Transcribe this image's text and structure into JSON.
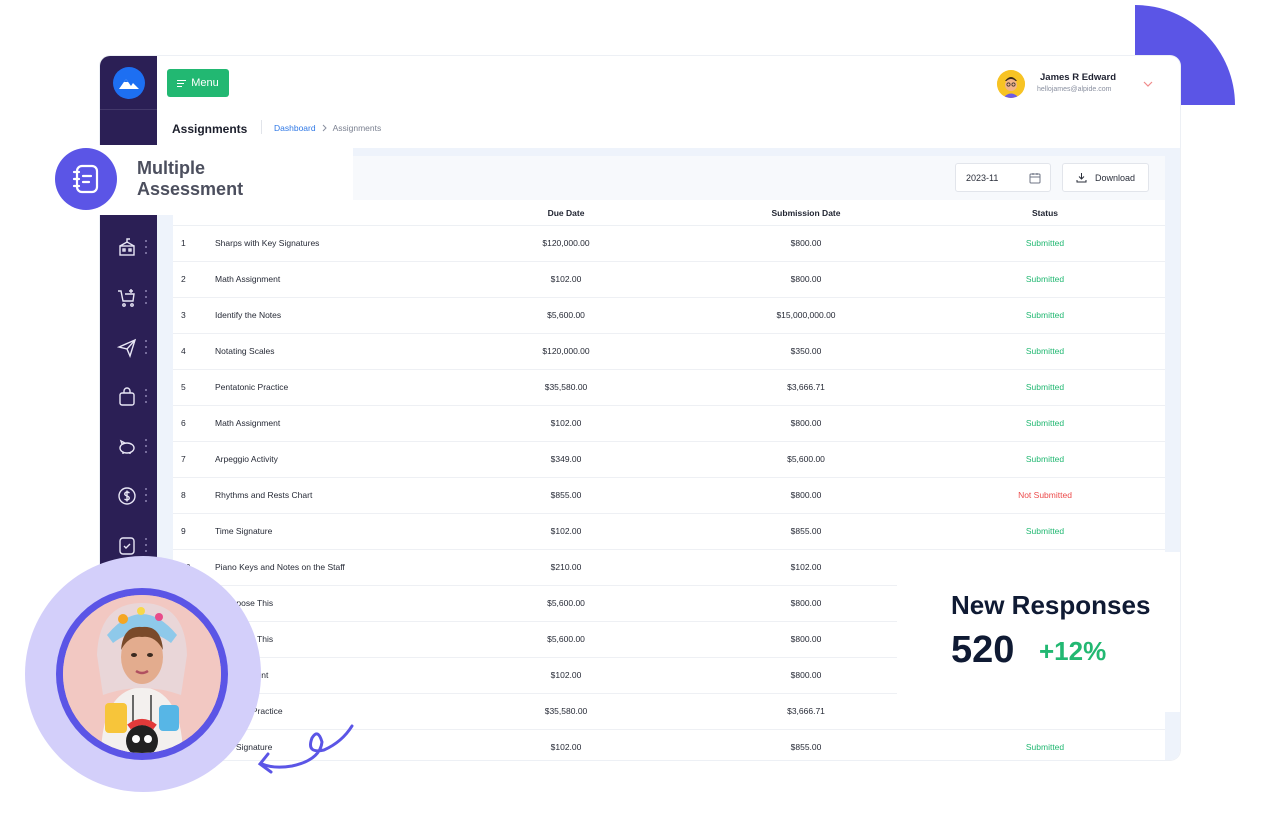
{
  "header": {
    "menu_label": "Menu",
    "user_name": "James R Edward",
    "user_email": "hellojames@alpide.com",
    "page_title": "Assignments",
    "breadcrumb": [
      {
        "label": "Dashboard"
      },
      {
        "label": "Assignments"
      }
    ]
  },
  "sidebar": {
    "items": [
      {
        "icon": "school-icon"
      },
      {
        "icon": "cart-add-icon"
      },
      {
        "icon": "send-icon"
      },
      {
        "icon": "shopping-bag-icon"
      },
      {
        "icon": "piggy-bank-icon"
      },
      {
        "icon": "dollar-circle-icon"
      },
      {
        "icon": "document-check-icon"
      }
    ]
  },
  "toolbar": {
    "date_value": "2023-11",
    "download_label": "Download"
  },
  "table": {
    "columns": {
      "due": "Due Date",
      "submission": "Submission Date",
      "status": "Status"
    },
    "rows": [
      {
        "num": "1",
        "name": "Sharps with Key Signatures",
        "due": "$120,000.00",
        "submission": "$800.00",
        "status": "Submitted",
        "state": "ok"
      },
      {
        "num": "2",
        "name": "Math Assignment",
        "due": "$102.00",
        "submission": "$800.00",
        "status": "Submitted",
        "state": "ok"
      },
      {
        "num": "3",
        "name": "Identify the Notes",
        "due": "$5,600.00",
        "submission": "$15,000,000.00",
        "status": "Submitted",
        "state": "ok"
      },
      {
        "num": "4",
        "name": "Notating Scales",
        "due": "$120,000.00",
        "submission": "$350.00",
        "status": "Submitted",
        "state": "ok"
      },
      {
        "num": "5",
        "name": "Pentatonic Practice",
        "due": "$35,580.00",
        "submission": "$3,666.71",
        "status": "Submitted",
        "state": "ok"
      },
      {
        "num": "6",
        "name": "Math Assignment",
        "due": "$102.00",
        "submission": "$800.00",
        "status": "Submitted",
        "state": "ok"
      },
      {
        "num": "7",
        "name": "Arpeggio Activity",
        "due": "$349.00",
        "submission": "$5,600.00",
        "status": "Submitted",
        "state": "ok"
      },
      {
        "num": "8",
        "name": "Rhythms and Rests Chart",
        "due": "$855.00",
        "submission": "$800.00",
        "status": "Not Submitted",
        "state": "bad"
      },
      {
        "num": "9",
        "name": "Time Signature",
        "due": "$102.00",
        "submission": "$855.00",
        "status": "Submitted",
        "state": "ok"
      },
      {
        "num": "10",
        "name": "Piano Keys and Notes on the Staff",
        "due": "$210.00",
        "submission": "$102.00",
        "status": "",
        "state": "ok"
      },
      {
        "num": "",
        "name": "Transpose This",
        "due": "$5,600.00",
        "submission": "$800.00",
        "status": "",
        "state": "ok"
      },
      {
        "num": "",
        "name": "Transpose This",
        "due": "$5,600.00",
        "submission": "$800.00",
        "status": "",
        "state": "ok"
      },
      {
        "num": "",
        "name": "th Assignment",
        "due": "$102.00",
        "submission": "$800.00",
        "status": "",
        "state": "ok"
      },
      {
        "num": "",
        "name": "entatonic Practice",
        "due": "$35,580.00",
        "submission": "$3,666.71",
        "status": "",
        "state": "ok"
      },
      {
        "num": "",
        "name": "Time Signature",
        "due": "$102.00",
        "submission": "$855.00",
        "status": "Submitted",
        "state": "ok"
      }
    ]
  },
  "feature_badge": {
    "label": "Multiple Assessment",
    "icon": "notebook-icon"
  },
  "stat_card": {
    "title": "New Responses",
    "value": "520",
    "change": "+12%"
  },
  "colors": {
    "sidebar": "#2b1f55",
    "accent_purple": "#5b55e6",
    "success_green": "#22b872",
    "danger_red": "#ec4b4b",
    "link_blue": "#2f78e6"
  }
}
